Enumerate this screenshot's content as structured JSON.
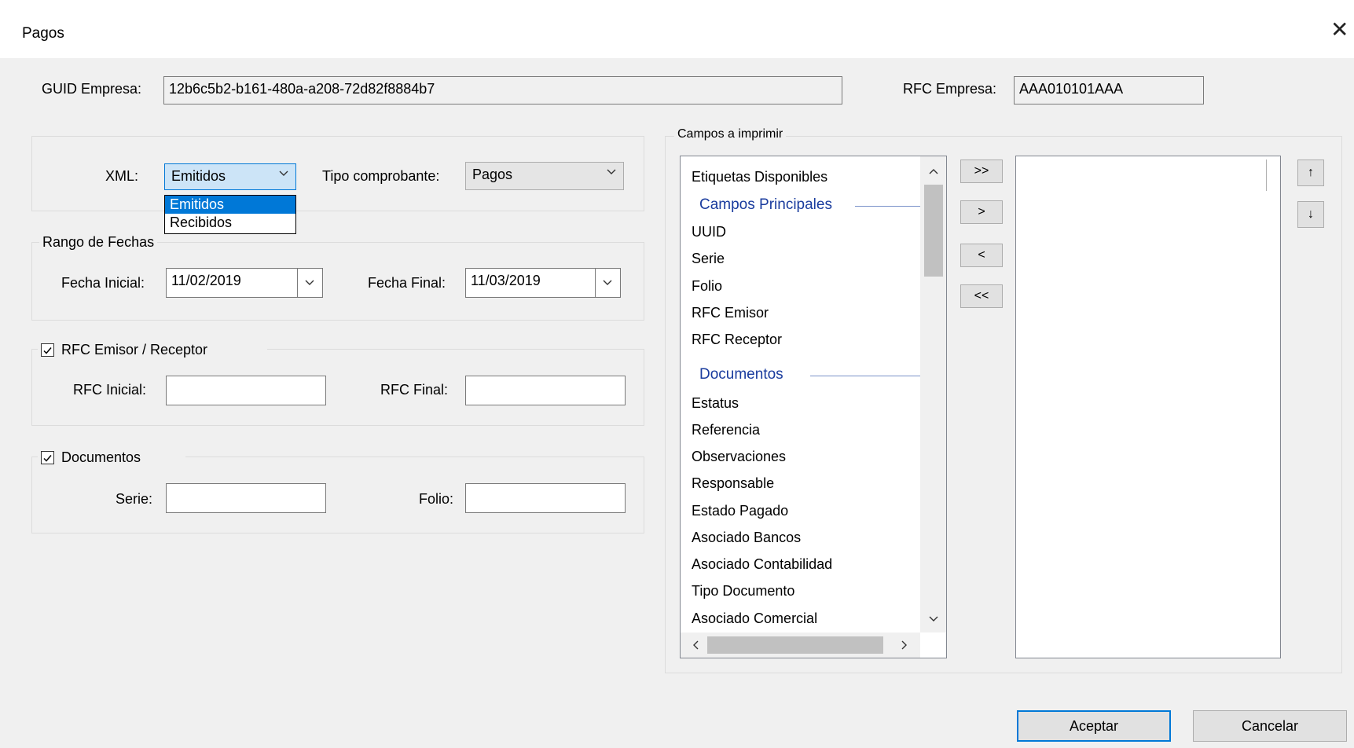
{
  "window": {
    "title": "Pagos"
  },
  "empresa": {
    "guid_label": "GUID Empresa:",
    "guid_value": "12b6c5b2-b161-480a-a208-72d82f8884b7",
    "rfc_label": "RFC Empresa:",
    "rfc_value": "AAA010101AAA"
  },
  "xml_group": {
    "xml_label": "XML:",
    "xml_selected": "Emitidos",
    "xml_options": [
      "Emitidos",
      "Recibidos"
    ],
    "tipo_label": "Tipo comprobante:",
    "tipo_selected": "Pagos"
  },
  "fechas": {
    "legend": "Rango de Fechas",
    "inicial_label": "Fecha Inicial:",
    "inicial_value": "11/02/2019",
    "final_label": "Fecha Final:",
    "final_value": "11/03/2019"
  },
  "rfc_group": {
    "legend": "RFC Emisor / Receptor",
    "checked": true,
    "inicial_label": "RFC Inicial:",
    "inicial_value": "",
    "final_label": "RFC Final:",
    "final_value": ""
  },
  "documentos_group": {
    "legend": "Documentos",
    "checked": true,
    "serie_label": "Serie:",
    "serie_value": "",
    "folio_label": "Folio:",
    "folio_value": ""
  },
  "campos": {
    "legend": "Campos a imprimir",
    "available_header": "Etiquetas Disponibles",
    "categories": [
      "Campos Principales",
      "Documentos"
    ],
    "principales": [
      "UUID",
      "Serie",
      "Folio",
      "RFC Emisor",
      "RFC Receptor"
    ],
    "documentos": [
      "Estatus",
      "Referencia",
      "Observaciones",
      "Responsable",
      "Estado Pagado",
      "Asociado Bancos",
      "Asociado Contabilidad",
      "Tipo Documento",
      "Asociado Comercial"
    ],
    "transfer_buttons": [
      ">>",
      ">",
      "<",
      "<<"
    ],
    "order_buttons": [
      "↑",
      "↓"
    ]
  },
  "buttons": {
    "accept": "Aceptar",
    "cancel": "Cancelar"
  },
  "colors": {
    "accent": "#0078d7",
    "category": "#1a3c9e",
    "background": "#f0f0f0"
  }
}
